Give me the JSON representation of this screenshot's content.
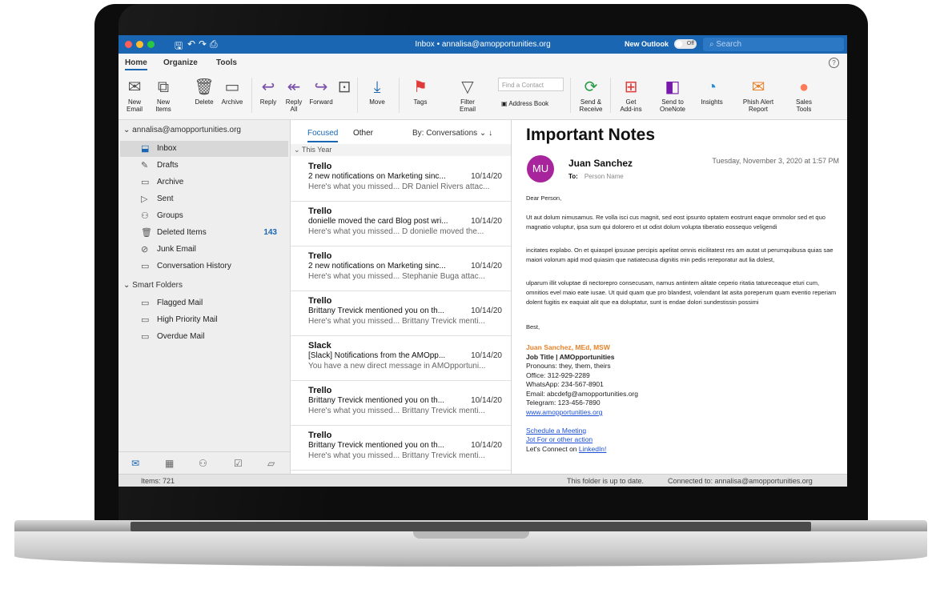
{
  "window": {
    "title": "Inbox • annalisa@amopportunities.org",
    "new_outlook_label": "New Outlook",
    "toggle_state": "Off",
    "search_placeholder": "Search"
  },
  "tabs": [
    "Home",
    "Organize",
    "Tools"
  ],
  "ribbon": {
    "new_email": "New\nEmail",
    "new_items": "New\nItems",
    "delete": "Delete",
    "archive": "Archive",
    "reply": "Reply",
    "reply_all": "Reply\nAll",
    "forward": "Forward",
    "move": "Move",
    "tags": "Tags",
    "filter_email": "Filter\nEmail",
    "find_contact": "Find a Contact",
    "address_book": "Address Book",
    "send_receive": "Send &\nReceive",
    "get_addins": "Get\nAdd-ins",
    "send_onenote": "Send to\nOneNote",
    "insights": "Insights",
    "phish_alert": "Phish Alert\nReport",
    "sales_tools": "Sales\nTools"
  },
  "sidebar": {
    "account": "annalisa@amopportunities.org",
    "items": [
      {
        "label": "Inbox",
        "icon": "inbox-icon",
        "count": ""
      },
      {
        "label": "Drafts",
        "icon": "drafts-icon",
        "count": ""
      },
      {
        "label": "Archive",
        "icon": "archive-icon",
        "count": ""
      },
      {
        "label": "Sent",
        "icon": "sent-icon",
        "count": ""
      },
      {
        "label": "Groups",
        "icon": "groups-icon",
        "count": ""
      },
      {
        "label": "Deleted Items",
        "icon": "trash-icon",
        "count": "143"
      },
      {
        "label": "Junk Email",
        "icon": "junk-icon",
        "count": ""
      },
      {
        "label": "Conversation History",
        "icon": "folder-icon",
        "count": ""
      }
    ],
    "smart_folders_label": "Smart Folders",
    "smart_folders": [
      "Flagged Mail",
      "High Priority Mail",
      "Overdue Mail"
    ]
  },
  "message_list": {
    "tab_focused": "Focused",
    "tab_other": "Other",
    "sort_label": "By: Conversations",
    "group_header": "This Year",
    "messages": [
      {
        "sender": "Trello",
        "subject": "2 new notifications on Marketing sinc...",
        "date": "10/14/20",
        "preview": "Here's what you missed... DR Daniel Rivers attac..."
      },
      {
        "sender": "Trello",
        "subject": "donielle moved the card Blog post wri...",
        "date": "10/14/20",
        "preview": "Here's what you missed... D donielle moved the..."
      },
      {
        "sender": "Trello",
        "subject": "2 new notifications on Marketing sinc...",
        "date": "10/14/20",
        "preview": "Here's what you missed... Stephanie Buga attac..."
      },
      {
        "sender": "Trello",
        "subject": "Brittany Trevick mentioned you on th...",
        "date": "10/14/20",
        "preview": "Here's what you missed... Brittany Trevick menti..."
      },
      {
        "sender": "Slack",
        "subject": "[Slack] Notifications from the AMOpp...",
        "date": "10/14/20",
        "preview": "You have a new direct message in AMOpportuni..."
      },
      {
        "sender": "Trello",
        "subject": "Brittany Trevick mentioned you on th...",
        "date": "10/14/20",
        "preview": "Here's what you missed... Brittany Trevick menti..."
      },
      {
        "sender": "Trello",
        "subject": "Brittany Trevick mentioned you on th...",
        "date": "10/14/20",
        "preview": "Here's what you missed... Brittany Trevick menti..."
      }
    ]
  },
  "reading_pane": {
    "subject": "Important Notes",
    "avatar_initials": "MU",
    "from": "Juan Sanchez",
    "to_label": "To:",
    "to_value": "Person Name",
    "date": "Tuesday, November 3, 2020 at 1:57 PM",
    "greeting": "Dear Person,",
    "paragraphs": [
      "Ut aut dolum nimusamus. Re volla isci cus magnit, sed eost ipsunto optatem eostrunt eaque ommolor sed et quo magnatio voluptur, ipsa sum qui dolorero et ut odist dolum volupta tiberatio eossequo veligendi",
      "incitates explabo. On et quiaspel ipsusae percipis apelitat omnis eicilitatest res am autat ut perumquibusa quias sae maiori volorum apid mod quiasim que natiatecusa dignitis min pedis rereporatur aut lia dolest,",
      "ulparum illit voluptae di nectorepro consecusam, namus antintem alitate ceperio ritatia tatureceaque eturi cum, omnitios evel maio eate iusae. Ut quid quam que pro blandest, volendant lat asita poreperum quam eventio reperiam dolent fugitis ex eaquiat alit que ea doluptatur, sunt is endae dolori sundestissin possimi"
    ],
    "closing": "Best,",
    "signature": {
      "name": "Juan Sanchez, MEd, MSW",
      "title": "Job Title | AMOpportunities",
      "pronouns": "Pronouns: they, them, theirs",
      "office": "Office: 312-929-2289",
      "whatsapp": "WhatsApp: 234-567-8901",
      "email": "Email: abcdefg@amopportunities.org",
      "telegram": "Telegram: 123-456-7890",
      "website": "www.amopportunities.org",
      "schedule": "Schedule a Meeting",
      "jotfor": "Jot For or other action",
      "connect_prefix": "Let's Connect on ",
      "linkedin": "LinkedIn!"
    }
  },
  "status_bar": {
    "items": "Items: 721",
    "sync": "This folder is up to date.",
    "connection": "Connected to: annalisa@amopportunities.org"
  },
  "colors": {
    "accent": "#1a66b3",
    "avatar": "#a8249c",
    "signature_name": "#e8822a",
    "link": "#1a4fd6"
  }
}
